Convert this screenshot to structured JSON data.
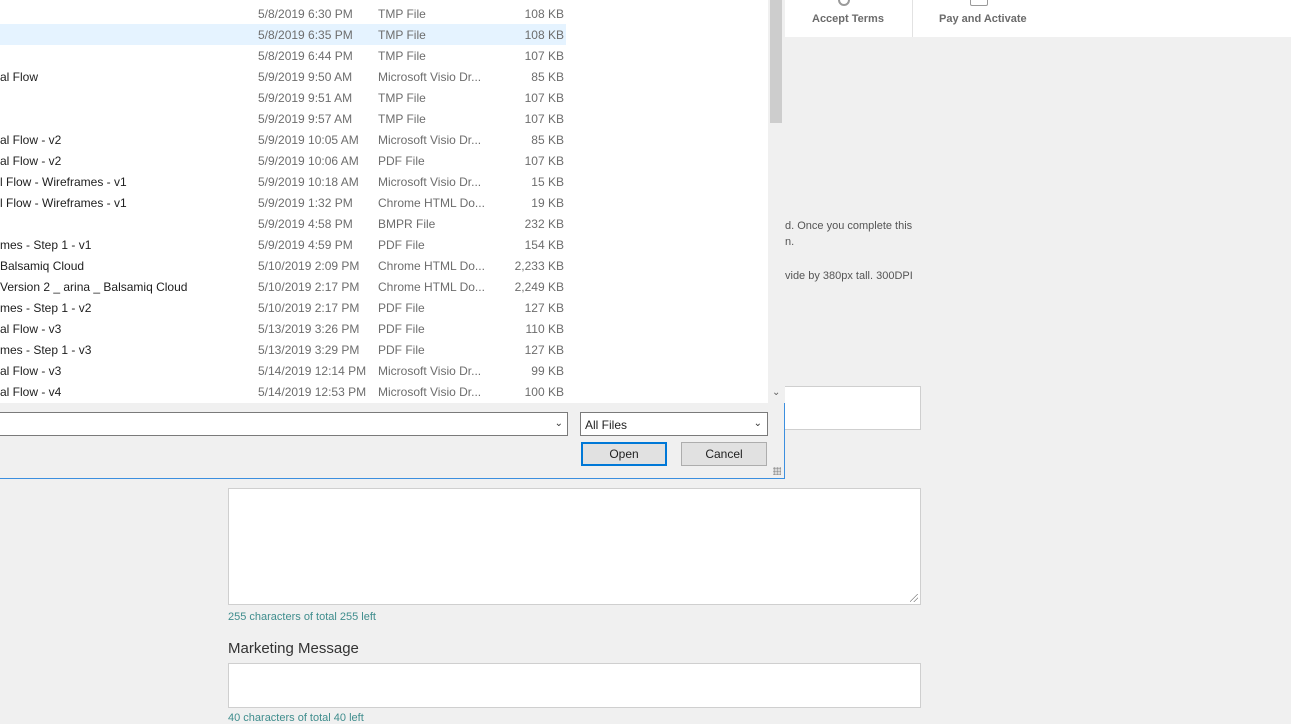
{
  "steps": {
    "accept_terms": "Accept Terms",
    "pay_and_activate": "Pay and Activate"
  },
  "info": {
    "line1": "d. Once you complete this",
    "line2": "n.",
    "line3": "vide by 380px tall. 300DPI"
  },
  "form": {
    "description_counter": "255 characters of total 255 left",
    "marketing_label": "Marketing Message",
    "marketing_counter": "40 characters of total 40 left"
  },
  "dialog": {
    "files": [
      {
        "name": "",
        "date": "5/8/2019 6:30 PM",
        "type": "TMP File",
        "size": "108 KB"
      },
      {
        "name": "",
        "date": "5/8/2019 6:35 PM",
        "type": "TMP File",
        "size": "108 KB",
        "selected": true
      },
      {
        "name": "",
        "date": "5/8/2019 6:44 PM",
        "type": "TMP File",
        "size": "107 KB"
      },
      {
        "name": "al Flow",
        "date": "5/9/2019 9:50 AM",
        "type": "Microsoft Visio Dr...",
        "size": "85 KB"
      },
      {
        "name": "",
        "date": "5/9/2019 9:51 AM",
        "type": "TMP File",
        "size": "107 KB"
      },
      {
        "name": "",
        "date": "5/9/2019 9:57 AM",
        "type": "TMP File",
        "size": "107 KB"
      },
      {
        "name": "al Flow - v2",
        "date": "5/9/2019 10:05 AM",
        "type": "Microsoft Visio Dr...",
        "size": "85 KB"
      },
      {
        "name": "al Flow - v2",
        "date": "5/9/2019 10:06 AM",
        "type": "PDF File",
        "size": "107 KB"
      },
      {
        "name": "l Flow - Wireframes - v1",
        "date": "5/9/2019 10:18 AM",
        "type": "Microsoft Visio Dr...",
        "size": "15 KB"
      },
      {
        "name": "l Flow - Wireframes - v1",
        "date": "5/9/2019 1:32 PM",
        "type": "Chrome HTML Do...",
        "size": "19 KB"
      },
      {
        "name": "",
        "date": "5/9/2019 4:58 PM",
        "type": "BMPR File",
        "size": "232 KB"
      },
      {
        "name": "mes - Step 1 - v1",
        "date": "5/9/2019 4:59 PM",
        "type": "PDF File",
        "size": "154 KB"
      },
      {
        "name": " Balsamiq Cloud",
        "date": "5/10/2019 2:09 PM",
        "type": "Chrome HTML Do...",
        "size": "2,233 KB"
      },
      {
        "name": "Version 2 _ arina _ Balsamiq Cloud",
        "date": "5/10/2019 2:17 PM",
        "type": "Chrome HTML Do...",
        "size": "2,249 KB"
      },
      {
        "name": "mes - Step 1 - v2",
        "date": "5/10/2019 2:17 PM",
        "type": "PDF File",
        "size": "127 KB"
      },
      {
        "name": "al Flow - v3",
        "date": "5/13/2019 3:26 PM",
        "type": "PDF File",
        "size": "110 KB"
      },
      {
        "name": "mes - Step 1 - v3",
        "date": "5/13/2019 3:29 PM",
        "type": "PDF File",
        "size": "127 KB"
      },
      {
        "name": "al Flow - v3",
        "date": "5/14/2019 12:14 PM",
        "type": "Microsoft Visio Dr...",
        "size": "99 KB"
      },
      {
        "name": "al Flow - v4",
        "date": "5/14/2019 12:53 PM",
        "type": "Microsoft Visio Dr...",
        "size": "100 KB"
      }
    ],
    "filename_value": "",
    "file_type_filter": "All Files",
    "open_label": "Open",
    "cancel_label": "Cancel",
    "colors": {
      "selection": "#e5f3ff",
      "focus_border": "#0078d7",
      "counter_text": "#3f8d8d"
    },
    "icons": [
      "chevron-down-icon",
      "scroll-down-icon",
      "size-grip-icon",
      "resize-grip-icon"
    ]
  }
}
